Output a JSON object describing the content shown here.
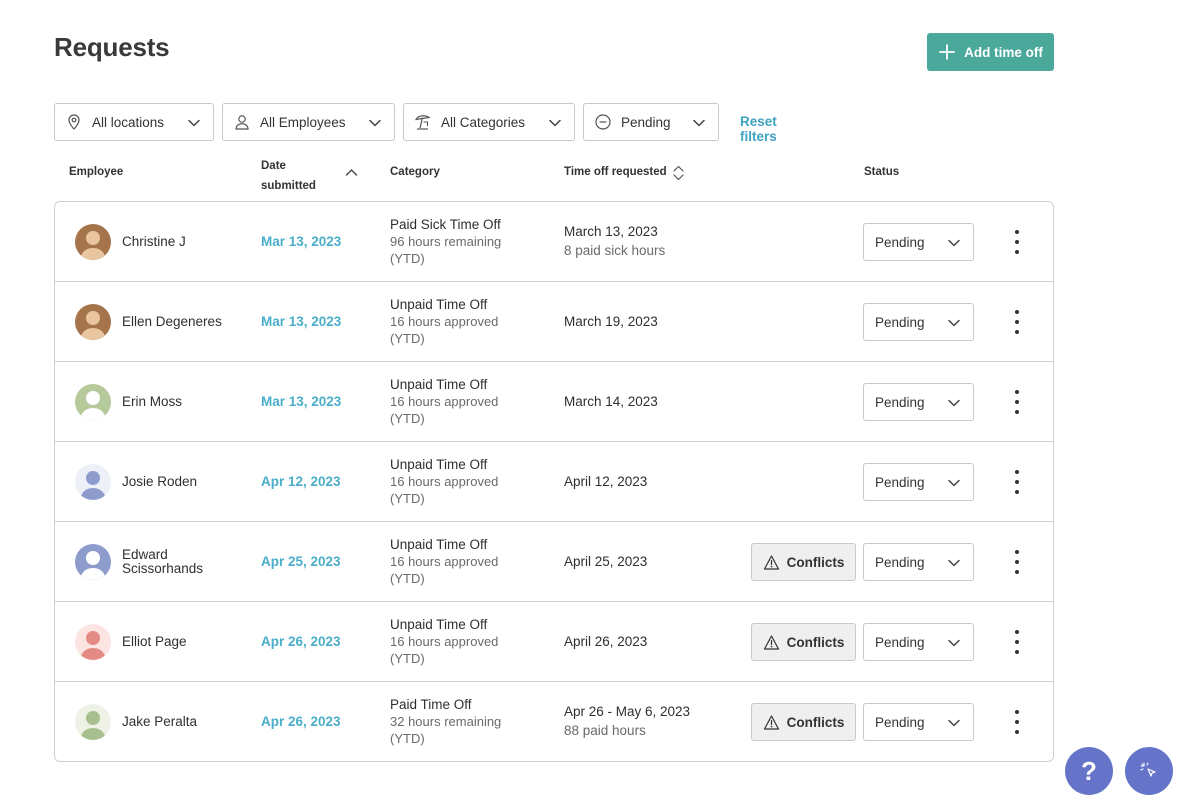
{
  "page": {
    "title": "Requests"
  },
  "actions": {
    "add_time_off": "Add time off",
    "reset_filters": "Reset filters"
  },
  "filters": {
    "location": "All locations",
    "employees": "All Employees",
    "categories": "All Categories",
    "status": "Pending"
  },
  "columns": {
    "employee": "Employee",
    "date_submitted_line1": "Date",
    "date_submitted_line2": "submitted",
    "category": "Category",
    "time_off_requested": "Time off requested",
    "status": "Status"
  },
  "rows": [
    {
      "name": "Christine J",
      "date": "Mar 13, 2023",
      "category": "Paid Sick Time Off",
      "balance": "96 hours remaining",
      "balance_period": "(YTD)",
      "requested": "March 13, 2023",
      "requested_detail": "8 paid sick hours",
      "conflicts": "",
      "status": "Pending",
      "avatar_color": "#a5744a",
      "avatar_skin": "#e9c6a0"
    },
    {
      "name": "Ellen Degeneres",
      "date": "Mar 13, 2023",
      "category": "Unpaid Time Off",
      "balance": "16 hours approved",
      "balance_period": "(YTD)",
      "requested": "March 19, 2023",
      "requested_detail": "",
      "conflicts": "",
      "status": "Pending",
      "avatar_color": "#a5744a",
      "avatar_skin": "#e9c6a0"
    },
    {
      "name": "Erin Moss",
      "date": "Mar 13, 2023",
      "category": "Unpaid Time Off",
      "balance": "16 hours approved",
      "balance_period": "(YTD)",
      "requested": "March 14, 2023",
      "requested_detail": "",
      "conflicts": "",
      "status": "Pending",
      "avatar_color": "#b5c99a",
      "avatar_skin": "#ffffff"
    },
    {
      "name": "Josie Roden",
      "date": "Apr 12, 2023",
      "category": "Unpaid Time Off",
      "balance": "16 hours approved",
      "balance_period": "(YTD)",
      "requested": "April 12, 2023",
      "requested_detail": "",
      "conflicts": "",
      "status": "Pending",
      "avatar_color": "#eef0f8",
      "avatar_skin": "#8e9ccd"
    },
    {
      "name": "Edward Scissorhands",
      "date": "Apr 25, 2023",
      "category": "Unpaid Time Off",
      "balance": "16 hours approved",
      "balance_period": "(YTD)",
      "requested": "April 25, 2023",
      "requested_detail": "",
      "conflicts": "Conflicts",
      "status": "Pending",
      "avatar_color": "#8e9ccd",
      "avatar_skin": "#ffffff"
    },
    {
      "name": "Elliot Page",
      "date": "Apr 26, 2023",
      "category": "Unpaid Time Off",
      "balance": "16 hours approved",
      "balance_period": "(YTD)",
      "requested": "April 26, 2023",
      "requested_detail": "",
      "conflicts": "Conflicts",
      "status": "Pending",
      "avatar_color": "#fbe4e2",
      "avatar_skin": "#e48a84"
    },
    {
      "name": "Jake Peralta",
      "date": "Apr 26, 2023",
      "category": "Paid Time Off",
      "balance": "32 hours remaining",
      "balance_period": "(YTD)",
      "requested": "Apr 26 - May 6, 2023",
      "requested_detail": "88 paid hours",
      "conflicts": "Conflicts",
      "status": "Pending",
      "avatar_color": "#eef2e6",
      "avatar_skin": "#a6bf8c"
    }
  ],
  "help": {
    "label": "?"
  },
  "colors": {
    "accent": "#4aa99b",
    "link": "#4aaecb",
    "fab": "#6574c9"
  }
}
